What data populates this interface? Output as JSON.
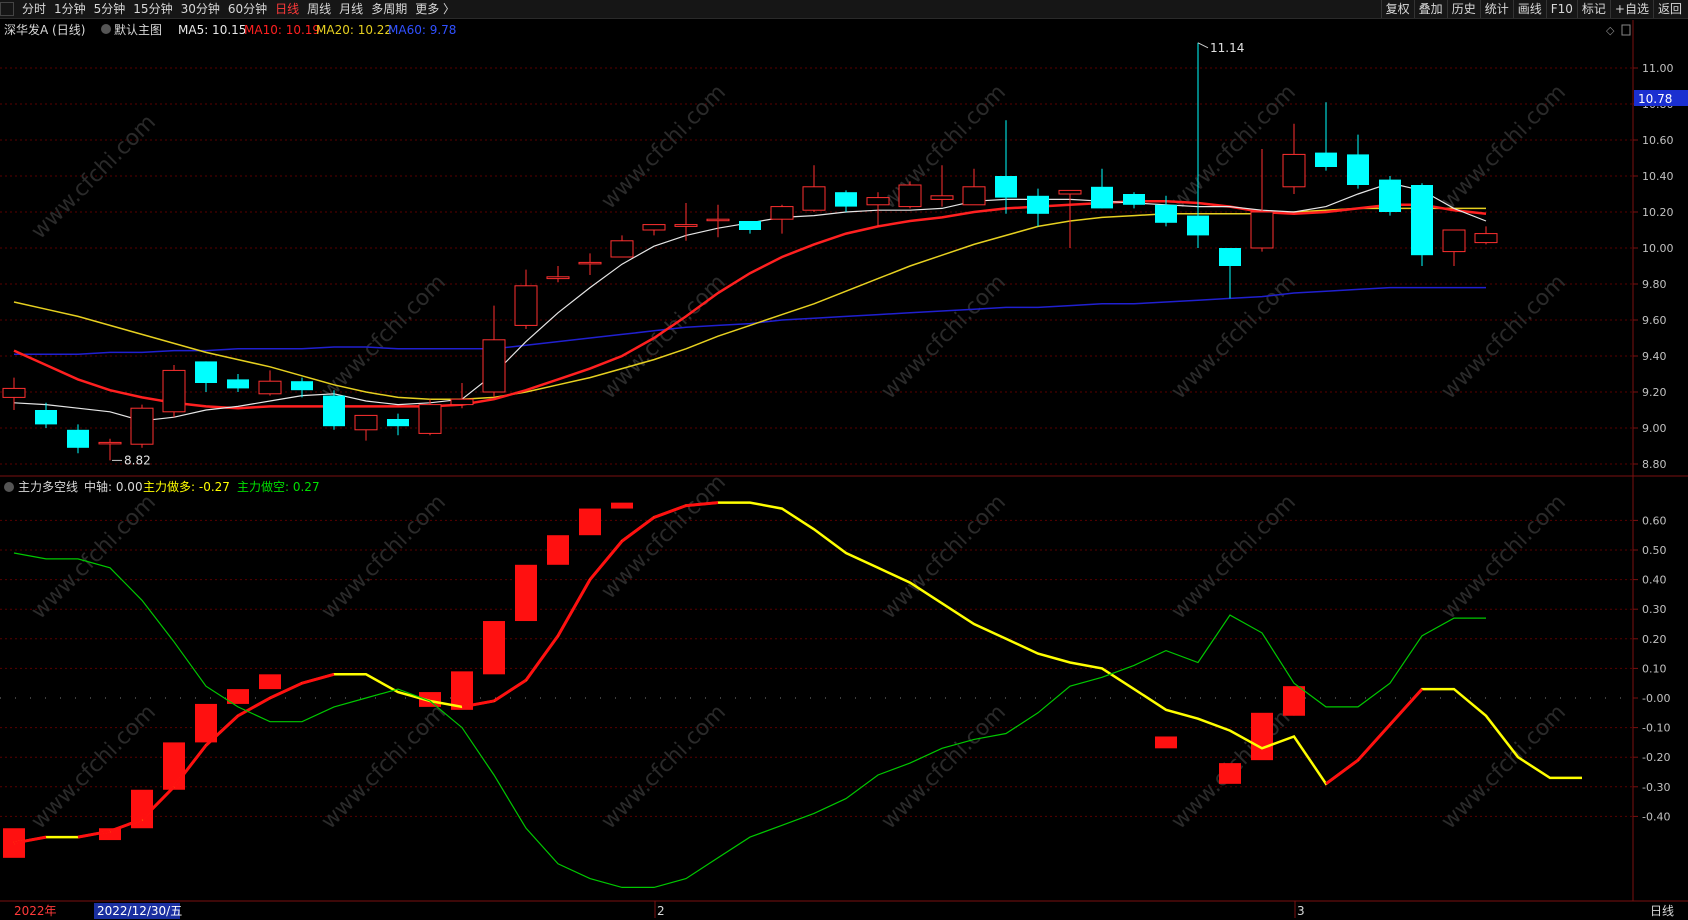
{
  "topbar": {
    "periods": [
      "分时",
      "1分钟",
      "5分钟",
      "15分钟",
      "30分钟",
      "60分钟",
      "日线",
      "周线",
      "月线",
      "多周期",
      "更多 〉"
    ],
    "active_period": "日线",
    "tools": [
      "复权",
      "叠加",
      "历史",
      "统计",
      "画线",
      "F10",
      "标记",
      "+自选",
      "返回"
    ]
  },
  "main_legend": {
    "stock": "深华发A (日线)",
    "template": "默认主图",
    "ma5": "MA5: 10.15",
    "ma10": "MA10: 10.19",
    "ma20": "MA20: 10.22",
    "ma60": "MA60: 9.78"
  },
  "price_axis": {
    "ticks": [
      "11.00",
      "10.80",
      "10.60",
      "10.40",
      "10.20",
      "10.00",
      "9.80",
      "9.60",
      "9.40",
      "9.20",
      "9.00",
      "8.80"
    ],
    "current_price": "10.78",
    "high_label": "11.14",
    "low_label": "8.82"
  },
  "indicator_legend": {
    "name": "主力多空线",
    "axis": "中轴: 0.00",
    "long": "主力做多: -0.27",
    "short": "主力做空: 0.27"
  },
  "indicator_axis": {
    "ticks": [
      "0.60",
      "0.50",
      "0.40",
      "0.30",
      "0.20",
      "0.10",
      "-0.00",
      "-0.10",
      "-0.20",
      "-0.30",
      "-0.40"
    ]
  },
  "date_axis": {
    "year_label": "2022年",
    "cursor_date": "2022/12/30/五",
    "month_markers": [
      "2",
      "3"
    ],
    "period": "日线"
  },
  "watermark": "www.cfchi.com",
  "colors": {
    "up": "#ff3030",
    "down": "#00ffff",
    "ma5": "#e6e6e6",
    "ma10": "#ff2020",
    "ma20": "#e6d020",
    "ma60": "#2020d0",
    "long_line": "#ffff00",
    "short_line": "#00c800"
  },
  "chart_data": [
    {
      "type": "candlestick",
      "title": "深华发A (日线)",
      "y_range": [
        8.7,
        11.2
      ],
      "candles": [
        {
          "o": 9.17,
          "h": 9.28,
          "l": 9.1,
          "c": 9.22
        },
        {
          "o": 9.1,
          "h": 9.14,
          "l": 9.0,
          "c": 9.02
        },
        {
          "o": 8.99,
          "h": 9.02,
          "l": 8.86,
          "c": 8.89
        },
        {
          "o": 8.92,
          "h": 8.94,
          "l": 8.82,
          "c": 8.92
        },
        {
          "o": 8.91,
          "h": 9.13,
          "l": 8.89,
          "c": 9.11
        },
        {
          "o": 9.09,
          "h": 9.35,
          "l": 9.06,
          "c": 9.32
        },
        {
          "o": 9.37,
          "h": 9.37,
          "l": 9.2,
          "c": 9.25
        },
        {
          "o": 9.27,
          "h": 9.3,
          "l": 9.2,
          "c": 9.22
        },
        {
          "o": 9.19,
          "h": 9.32,
          "l": 9.18,
          "c": 9.26
        },
        {
          "o": 9.26,
          "h": 9.28,
          "l": 9.17,
          "c": 9.21
        },
        {
          "o": 9.18,
          "h": 9.21,
          "l": 8.99,
          "c": 9.01
        },
        {
          "o": 8.99,
          "h": 9.07,
          "l": 8.93,
          "c": 9.07
        },
        {
          "o": 9.05,
          "h": 9.08,
          "l": 8.96,
          "c": 9.01
        },
        {
          "o": 8.97,
          "h": 9.16,
          "l": 8.96,
          "c": 9.13
        },
        {
          "o": 9.13,
          "h": 9.25,
          "l": 9.11,
          "c": 9.16
        },
        {
          "o": 9.2,
          "h": 9.68,
          "l": 9.17,
          "c": 9.49
        },
        {
          "o": 9.57,
          "h": 9.88,
          "l": 9.55,
          "c": 9.79
        },
        {
          "o": 9.83,
          "h": 9.9,
          "l": 9.81,
          "c": 9.84
        },
        {
          "o": 9.92,
          "h": 9.97,
          "l": 9.85,
          "c": 9.92
        },
        {
          "o": 9.95,
          "h": 10.07,
          "l": 9.97,
          "c": 10.04
        },
        {
          "o": 10.1,
          "h": 10.13,
          "l": 10.07,
          "c": 10.13
        },
        {
          "o": 10.12,
          "h": 10.25,
          "l": 10.04,
          "c": 10.13
        },
        {
          "o": 10.16,
          "h": 10.24,
          "l": 10.06,
          "c": 10.16
        },
        {
          "o": 10.15,
          "h": 10.15,
          "l": 10.08,
          "c": 10.1
        },
        {
          "o": 10.16,
          "h": 10.24,
          "l": 10.08,
          "c": 10.23
        },
        {
          "o": 10.21,
          "h": 10.46,
          "l": 10.2,
          "c": 10.34
        },
        {
          "o": 10.31,
          "h": 10.32,
          "l": 10.2,
          "c": 10.23
        },
        {
          "o": 10.24,
          "h": 10.31,
          "l": 10.12,
          "c": 10.28
        },
        {
          "o": 10.23,
          "h": 10.37,
          "l": 10.22,
          "c": 10.35
        },
        {
          "o": 10.27,
          "h": 10.46,
          "l": 10.23,
          "c": 10.29
        },
        {
          "o": 10.24,
          "h": 10.44,
          "l": 10.24,
          "c": 10.34
        },
        {
          "o": 10.4,
          "h": 10.71,
          "l": 10.19,
          "c": 10.28
        },
        {
          "o": 10.29,
          "h": 10.33,
          "l": 10.12,
          "c": 10.19
        },
        {
          "o": 10.3,
          "h": 10.31,
          "l": 10.0,
          "c": 10.32
        },
        {
          "o": 10.34,
          "h": 10.44,
          "l": 10.22,
          "c": 10.22
        },
        {
          "o": 10.3,
          "h": 10.31,
          "l": 10.22,
          "c": 10.24
        },
        {
          "o": 10.24,
          "h": 10.29,
          "l": 10.12,
          "c": 10.14
        },
        {
          "o": 10.18,
          "h": 11.14,
          "l": 10.0,
          "c": 10.07
        },
        {
          "o": 10.0,
          "h": 10.0,
          "l": 9.72,
          "c": 9.9
        },
        {
          "o": 10.0,
          "h": 10.55,
          "l": 9.98,
          "c": 10.2
        },
        {
          "o": 10.34,
          "h": 10.69,
          "l": 10.3,
          "c": 10.52
        },
        {
          "o": 10.53,
          "h": 10.81,
          "l": 10.43,
          "c": 10.45
        },
        {
          "o": 10.52,
          "h": 10.63,
          "l": 10.33,
          "c": 10.35
        },
        {
          "o": 10.38,
          "h": 10.4,
          "l": 10.18,
          "c": 10.2
        },
        {
          "o": 10.35,
          "h": 10.36,
          "l": 9.9,
          "c": 9.96
        },
        {
          "o": 9.98,
          "h": 10.09,
          "l": 9.9,
          "c": 10.1
        },
        {
          "o": 10.03,
          "h": 10.12,
          "l": 10.02,
          "c": 10.08
        }
      ],
      "ma5": [
        9.14,
        9.13,
        9.11,
        9.09,
        9.04,
        9.06,
        9.1,
        9.12,
        9.15,
        9.18,
        9.19,
        9.15,
        9.13,
        9.14,
        9.16,
        9.3,
        9.48,
        9.64,
        9.78,
        9.91,
        10.01,
        10.07,
        10.11,
        10.14,
        10.17,
        10.18,
        10.2,
        10.21,
        10.21,
        10.22,
        10.26,
        10.27,
        10.27,
        10.27,
        10.26,
        10.25,
        10.24,
        10.23,
        10.23,
        10.21,
        10.2,
        10.23,
        10.3,
        10.36,
        10.32,
        10.22,
        10.15
      ],
      "ma10": [
        9.43,
        9.35,
        9.27,
        9.21,
        9.17,
        9.14,
        9.12,
        9.11,
        9.12,
        9.12,
        9.12,
        9.12,
        9.12,
        9.12,
        9.13,
        9.16,
        9.21,
        9.27,
        9.33,
        9.4,
        9.5,
        9.62,
        9.75,
        9.86,
        9.95,
        10.02,
        10.08,
        10.12,
        10.15,
        10.17,
        10.2,
        10.22,
        10.23,
        10.24,
        10.25,
        10.26,
        10.26,
        10.25,
        10.23,
        10.2,
        10.19,
        10.2,
        10.22,
        10.24,
        10.24,
        10.21,
        10.19
      ],
      "ma20": [
        9.7,
        9.66,
        9.62,
        9.57,
        9.52,
        9.47,
        9.42,
        9.38,
        9.34,
        9.29,
        9.24,
        9.2,
        9.17,
        9.16,
        9.16,
        9.17,
        9.2,
        9.24,
        9.28,
        9.33,
        9.38,
        9.44,
        9.51,
        9.57,
        9.63,
        9.69,
        9.76,
        9.83,
        9.9,
        9.96,
        10.02,
        10.07,
        10.12,
        10.15,
        10.17,
        10.18,
        10.19,
        10.19,
        10.19,
        10.19,
        10.2,
        10.21,
        10.22,
        10.22,
        10.22,
        10.22,
        10.22
      ],
      "ma60": [
        9.41,
        9.41,
        9.41,
        9.42,
        9.42,
        9.43,
        9.43,
        9.44,
        9.44,
        9.44,
        9.45,
        9.45,
        9.44,
        9.44,
        9.44,
        9.44,
        9.46,
        9.48,
        9.5,
        9.52,
        9.54,
        9.56,
        9.57,
        9.58,
        9.6,
        9.61,
        9.62,
        9.63,
        9.64,
        9.65,
        9.66,
        9.67,
        9.67,
        9.68,
        9.69,
        9.69,
        9.7,
        9.71,
        9.72,
        9.73,
        9.75,
        9.76,
        9.77,
        9.78,
        9.78,
        9.78,
        9.78
      ]
    },
    {
      "type": "line",
      "title": "主力多空线",
      "y_range": [
        -0.58,
        0.72
      ],
      "series": [
        {
          "name": "主力做多",
          "values": [
            -0.49,
            -0.47,
            -0.47,
            -0.45,
            -0.41,
            -0.3,
            -0.16,
            -0.06,
            0.0,
            0.05,
            0.08,
            0.08,
            0.02,
            -0.01,
            -0.03,
            -0.01,
            0.06,
            0.21,
            0.4,
            0.53,
            0.61,
            0.65,
            0.66,
            0.66,
            0.64,
            0.57,
            0.49,
            0.44,
            0.39,
            0.32,
            0.25,
            0.2,
            0.15,
            0.12,
            0.1,
            0.03,
            -0.04,
            -0.07,
            -0.11,
            -0.17,
            -0.13,
            -0.29,
            -0.21,
            -0.09,
            0.03,
            0.03,
            -0.06,
            -0.2,
            -0.27,
            -0.27
          ]
        },
        {
          "name": "主力做空",
          "values": [
            0.49,
            0.47,
            0.47,
            0.44,
            0.33,
            0.19,
            0.04,
            -0.03,
            -0.08,
            -0.08,
            -0.03,
            0.0,
            0.03,
            -0.01,
            -0.1,
            -0.26,
            -0.44,
            -0.56,
            -0.61,
            -0.64,
            -0.64,
            -0.61,
            -0.54,
            -0.47,
            -0.43,
            -0.39,
            -0.34,
            -0.26,
            -0.22,
            -0.17,
            -0.14,
            -0.12,
            -0.05,
            0.04,
            0.07,
            0.11,
            0.16,
            0.12,
            0.28,
            0.22,
            0.05,
            -0.03,
            -0.03,
            0.05,
            0.21,
            0.27,
            0.27
          ]
        },
        {
          "name": "柱",
          "values": [
            -0.49,
            -0.47,
            -0.47,
            -0.46,
            -0.45,
            -0.4,
            -0.3,
            -0.17,
            -0.06,
            0.0,
            0.05,
            0.08,
            0.08,
            0.02,
            -0.01,
            -0.03,
            -0.01,
            0.06,
            0.21,
            0.4,
            0.53,
            0.61,
            0.65,
            0.66
          ]
        }
      ]
    }
  ]
}
